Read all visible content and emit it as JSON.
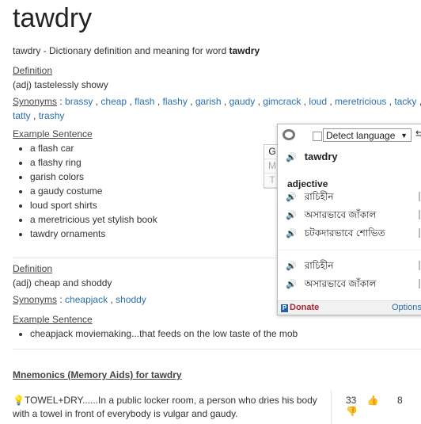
{
  "title": "tawdry",
  "subtitle_prefix": "tawdry - Dictionary definition and meaning for word ",
  "subtitle_word": "tawdry",
  "sense1": {
    "definition_label": "Definition",
    "definition": "(adj) tastelessly showy",
    "synonyms_label": "Synonyms",
    "synonyms_sep": " : ",
    "synonyms": [
      "brassy",
      "cheap",
      "flash",
      "flashy",
      "garish",
      "gaudy",
      "gimcrack",
      "loud",
      "meretricious",
      "tacky",
      "tatty",
      "trashy"
    ],
    "example_label": "Example Sentence",
    "examples": [
      "a flash car",
      "a flashy ring",
      "garish colors",
      "a gaudy costume",
      "loud sport shirts",
      "a meretricious yet stylish book",
      "tawdry ornaments"
    ]
  },
  "sense2": {
    "definition_label": "Definition",
    "definition": "(adj) cheap and shoddy",
    "synonyms_label": "Synonyms",
    "synonyms_sep": " : ",
    "synonyms": [
      "cheapjack",
      "shoddy"
    ],
    "example_label": "Example Sentence",
    "examples": [
      "cheapjack moviemaking...that feeds on the low taste of the mob"
    ]
  },
  "mnemonics": {
    "heading": "Mnemonics (Memory Aids) for tawdry",
    "text": "TOWEL+DRY......In a public locker room, a person who dries his body with a towel in front of everybody is vulgar and gaudy.",
    "upvotes": "33",
    "downvotes": "8",
    "bulb_icon": "lightbulb-icon"
  },
  "popup": {
    "tabs": [
      "G",
      "M",
      "T"
    ],
    "language_select": "Detect language",
    "word": "tawdry",
    "pos": "adjective",
    "translations": [
      "রাচিহীন",
      "অসারভাবে জাঁকাল",
      "চটকদারভাবে শোভিত"
    ],
    "translations2": [
      "রাচিহীন",
      "অসারভাবে জাঁকাল"
    ],
    "donate": "Donate",
    "options": "Options"
  }
}
